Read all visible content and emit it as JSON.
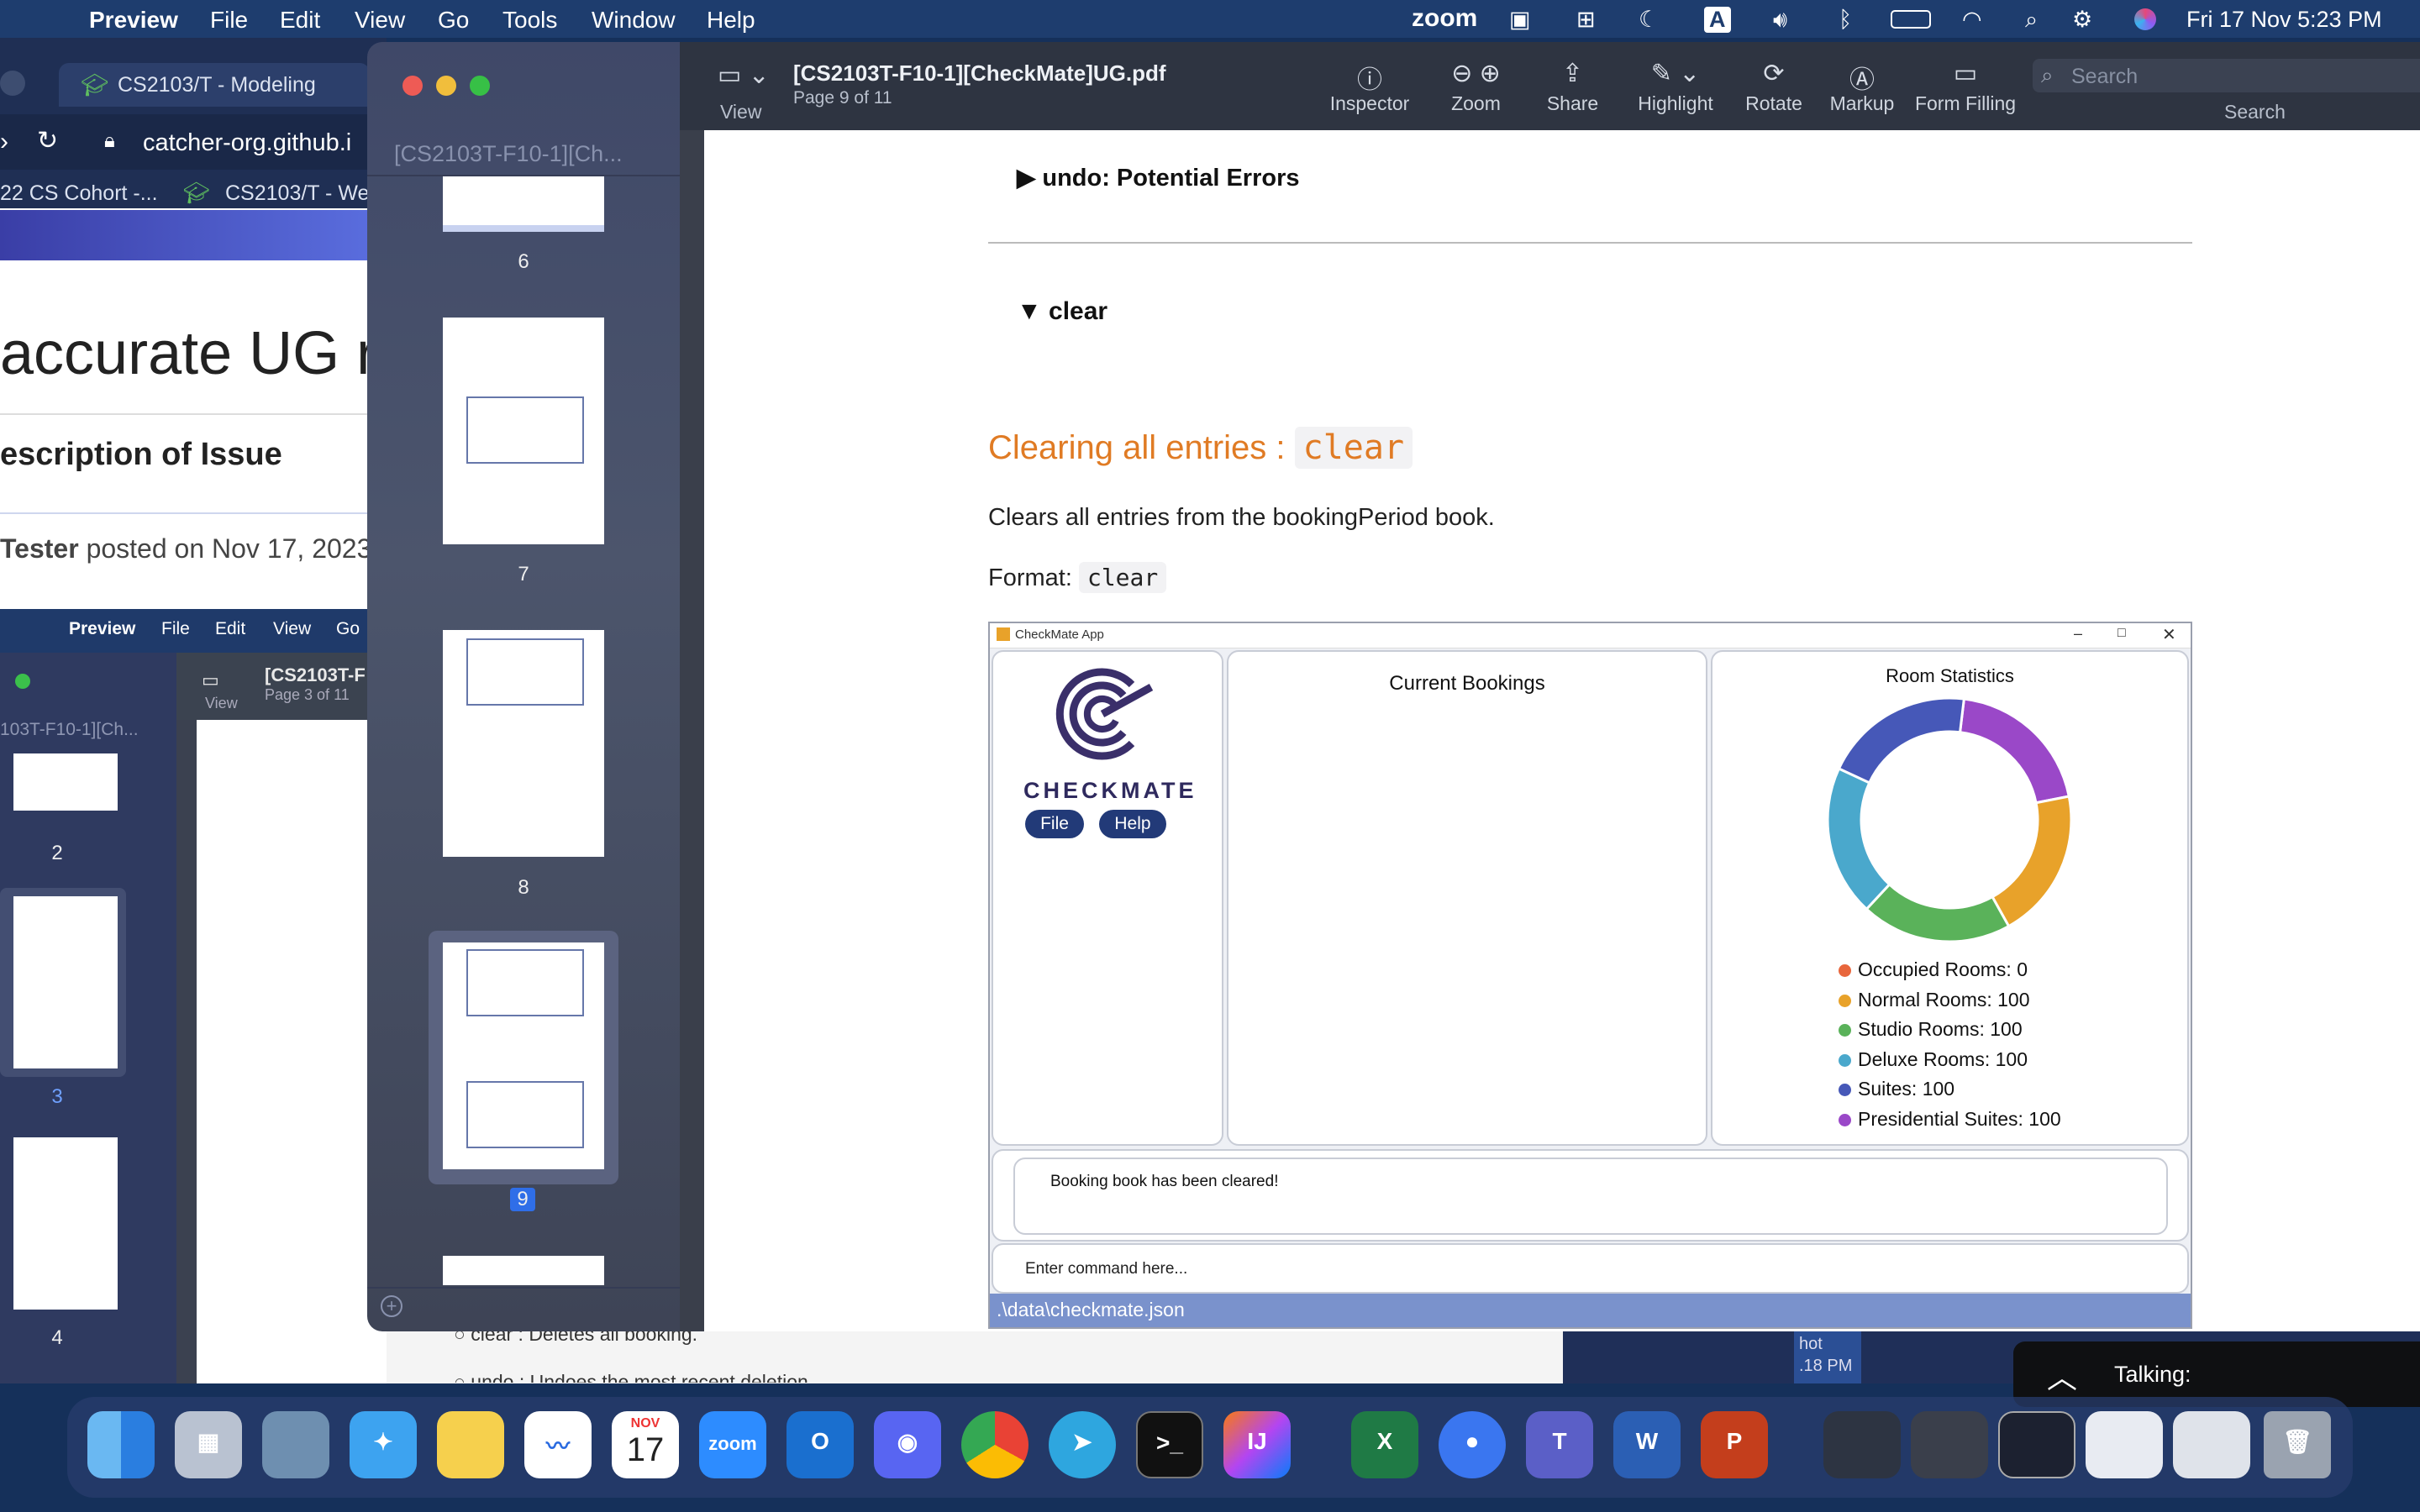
{
  "menubar": {
    "app_name": "Preview",
    "items": [
      "File",
      "Edit",
      "View",
      "Go",
      "Tools",
      "Window",
      "Help"
    ],
    "zoom_label": "zoom",
    "datetime": "Fri 17 Nov  5:23 PM"
  },
  "browser": {
    "tab1": "CS2103/T - Modeling",
    "address": "catcher-org.github.i",
    "bookmark1": "22 CS Cohort -...",
    "bookmark2": "CS2103/T - We",
    "heading": "accurate UG re",
    "subheading": "escription of Issue",
    "tester_name": "Tester",
    "posted_on": "posted on Nov 17, 2023",
    "footer_line1": "clear : Deletes all booking.",
    "footer_line2": "undo : Undoes the most recent deletion",
    "side_peek1": "hot",
    "side_peek2": ".18 PM"
  },
  "inner_preview": {
    "app_name": "Preview",
    "items": [
      "File",
      "Edit",
      "View",
      "Go"
    ],
    "sidebar_title": "103T-F10-1][Ch...",
    "doc_title": "[CS2103T-F",
    "page_info": "Page 3 of 11",
    "view_label": "View",
    "thumb_numbers": [
      "2",
      "3",
      "4"
    ]
  },
  "preview": {
    "doc_title": "[CS2103T-F10-1][CheckMate]UG.pdf",
    "page_info": "Page 9 of 11",
    "sidebar_title": "[CS2103T-F10-1][Ch...",
    "view_label": "View",
    "tools": [
      "Inspector",
      "Zoom",
      "Share",
      "Highlight",
      "Rotate",
      "Markup",
      "Form Filling"
    ],
    "search_placeholder": "Search",
    "search_label": "Search",
    "thumb_numbers": [
      "6",
      "7",
      "8",
      "9"
    ]
  },
  "pdf": {
    "undo_errors": "undo: Potential Errors",
    "clear_toggle": "clear",
    "section_title": "Clearing all entries : ",
    "section_code": "clear",
    "description": "Clears all entries from the bookingPeriod book.",
    "format_label": "Format: ",
    "format_code": "clear"
  },
  "checkmate": {
    "window_title": "CheckMate App",
    "logo_text": "CHECKMATE",
    "file_btn": "File",
    "help_btn": "Help",
    "bookings_title": "Current Bookings",
    "stats_title": "Room Statistics",
    "result_text": "Booking book has been cleared!",
    "command_placeholder": "Enter command here...",
    "status_path": ".\\data\\checkmate.json"
  },
  "chart_data": {
    "type": "pie",
    "title": "Room Statistics",
    "series": [
      {
        "name": "Occupied Rooms: 0",
        "value": 0,
        "color": "#e8663c"
      },
      {
        "name": "Normal Rooms: 100",
        "value": 100,
        "color": "#e8a22a"
      },
      {
        "name": "Studio Rooms: 100",
        "value": 100,
        "color": "#5ab25a"
      },
      {
        "name": "Deluxe Rooms: 100",
        "value": 100,
        "color": "#4aa8cc"
      },
      {
        "name": "Suites: 100",
        "value": 100,
        "color": "#4658b8"
      },
      {
        "name": "Presidential Suites: 100",
        "value": 100,
        "color": "#9a48c8"
      }
    ]
  },
  "talking": {
    "label": "Talking:"
  },
  "dock_apps": [
    "Finder",
    "Launchpad",
    "Preview",
    "Safari",
    "Notes",
    "Freeform",
    "Calendar",
    "Zoom",
    "Outlook",
    "Discord",
    "Chrome",
    "Telegram",
    "Terminal",
    "IntelliJ IDEA",
    "Excel",
    "Signal",
    "Teams",
    "Word",
    "PowerPoint",
    "Trash"
  ],
  "calendar": {
    "month": "NOV",
    "day": "17"
  }
}
